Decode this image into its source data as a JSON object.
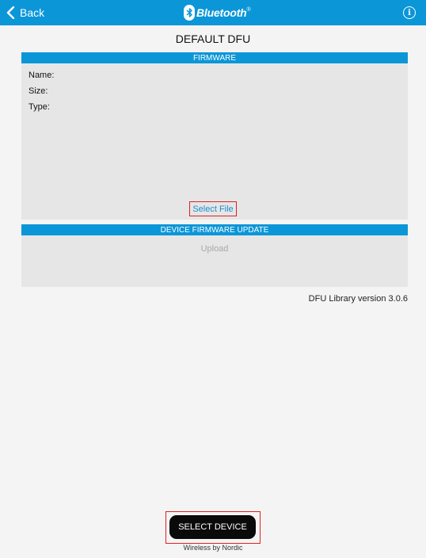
{
  "navbar": {
    "back_label": "Back",
    "logo_text": "Bluetooth",
    "logo_mark": "®",
    "info_icon": "i"
  },
  "page_title": "DEFAULT DFU",
  "firmware": {
    "header": "FIRMWARE",
    "name_label": "Name:",
    "size_label": "Size:",
    "type_label": "Type:",
    "select_file_label": "Select File"
  },
  "dfu": {
    "header": "DEVICE FIRMWARE UPDATE",
    "upload_label": "Upload"
  },
  "library_version": "DFU Library version 3.0.6",
  "select_device_label": "SELECT DEVICE",
  "footer": "Wireless by Nordic",
  "colors": {
    "accent": "#0b96d8",
    "background": "#f4f4f4",
    "panel": "#e6e6e6",
    "highlight_border": "#e02020",
    "link": "#1a8fd0"
  },
  "icons": [
    "chevron-left-icon",
    "bluetooth-icon",
    "info-icon"
  ]
}
